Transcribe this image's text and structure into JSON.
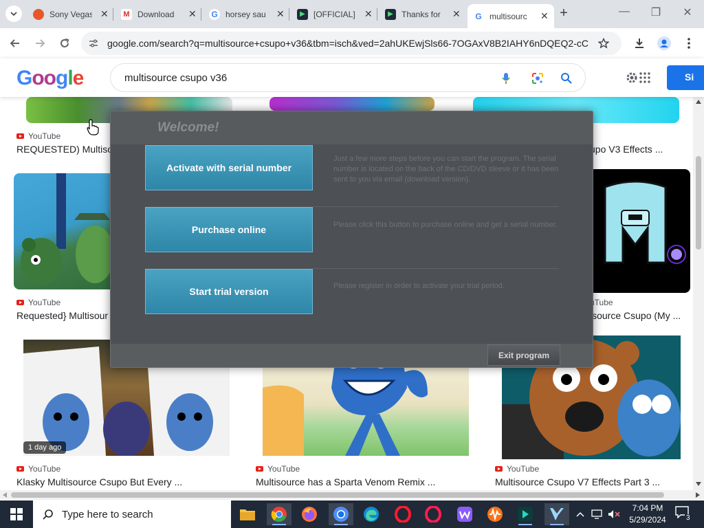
{
  "browser": {
    "tabs": [
      {
        "title": "Sony Vegas",
        "favicon_color": "#e8572a"
      },
      {
        "title": "Download",
        "favicon_color": "#d93025"
      },
      {
        "title": "horsey sau",
        "favicon_color": "#ffffff"
      },
      {
        "title": "[OFFICIAL]",
        "favicon_color": "#1f2937"
      },
      {
        "title": "Thanks for",
        "favicon_color": "#1f2937"
      },
      {
        "title": "multisourc",
        "favicon_color": "#ffffff"
      }
    ],
    "url": "google.com/search?q=multisource+csupo+v36&tbm=isch&ved=2ahUKEwjSls66-7OGAxV8B2IAHY6nDQEQ2-cC..."
  },
  "google": {
    "logo_text": "Google",
    "query": "multisource csupo v36",
    "signin_label": "Si"
  },
  "results": [
    {
      "source": "YouTube",
      "title": "REQUESTED) Multiso"
    },
    {
      "source": "",
      "title": "upo V3 Effects ..."
    },
    {
      "source": "YouTube",
      "title": "Requested} Multisour"
    },
    {
      "source": "uTube",
      "title": "isource Csupo (My ..."
    },
    {
      "source": "YouTube",
      "title": "Klasky Multisource Csupo But Every ...",
      "badge": "1 day ago"
    },
    {
      "source": "YouTube",
      "title": "Multisource has a Sparta Venom Remix ..."
    },
    {
      "source": "YouTube",
      "title": "Multisource Csupo V7 Effects Part 3 ..."
    }
  ],
  "dialog": {
    "title": "Welcome!",
    "buttons": [
      {
        "label": "Activate with serial number",
        "description": "Just a few more steps before you can start the program. The serial number is located on the back of the CD/DVD sleeve or it has been sent to you via email (download version)."
      },
      {
        "label": "Purchase online",
        "description": "Please click this button to purchase online and get a serial number."
      },
      {
        "label": "Start trial version",
        "description": "Please register in order to activate your trial period."
      }
    ],
    "exit_label": "Exit program"
  },
  "taskbar": {
    "search_placeholder": "Type here to search",
    "time": "7:04 PM",
    "date": "5/29/2024",
    "notification_count": "3",
    "apps": [
      "file-explorer",
      "chrome",
      "firefox",
      "chrome-alt",
      "edge",
      "opera",
      "opera-gx",
      "wattpad",
      "audio-app",
      "media-app",
      "capcut"
    ]
  },
  "colors": {
    "google_blue": "#4285f4",
    "dialog_button": "#3a95b8",
    "taskbar": "#1f2937"
  }
}
